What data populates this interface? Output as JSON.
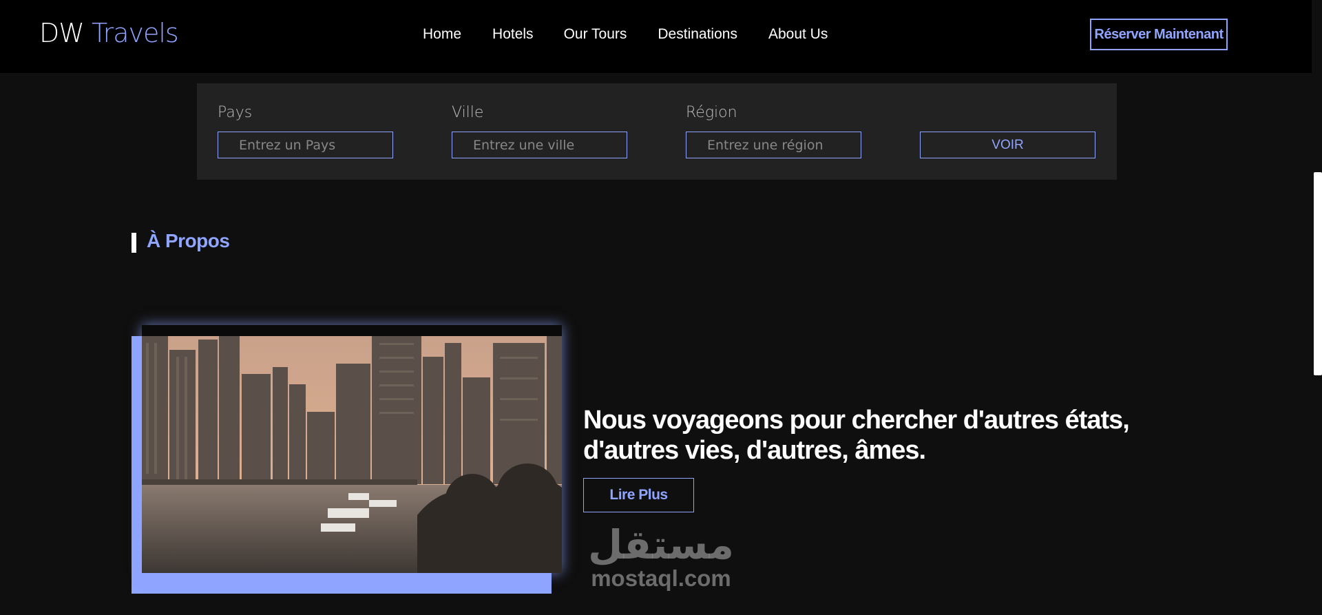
{
  "header": {
    "logo_main": "DW",
    "logo_accent": "Travels",
    "nav": [
      "Home",
      "Hotels",
      "Our Tours",
      "Destinations",
      "About Us"
    ],
    "cta": "Réserver Maintenant"
  },
  "search": {
    "country_label": "Pays",
    "country_placeholder": "Entrez un Pays",
    "city_label": "Ville",
    "city_placeholder": "Entrez une ville",
    "region_label": "Région",
    "region_placeholder": "Entrez une région",
    "submit": "VOIR"
  },
  "about": {
    "title": "À Propos",
    "quote": "Nous voyageons pour chercher d'autres états, d'autres vies, d'autres, âmes.",
    "read_more": "Lire Plus",
    "image_icon": "city-marina-photo"
  },
  "watermark": {
    "arabic": "مستقل",
    "latin": "mostaql.com"
  },
  "colors": {
    "accent": "#8fa5ff",
    "background": "#0f0f0f",
    "header": "#000000",
    "panel": "#222222"
  }
}
